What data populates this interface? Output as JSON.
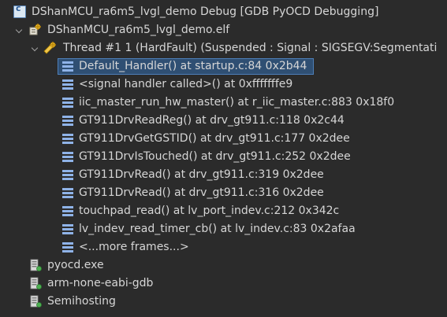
{
  "launch": {
    "label": "DShanMCU_ra6m5_lvgl_demo Debug [GDB PyOCD Debugging]",
    "icon": "launch-config-icon"
  },
  "process": {
    "label": "DShanMCU_ra6m5_lvgl_demo.elf",
    "icon": "debug-target-icon"
  },
  "thread": {
    "label": "Thread #1 1 (HardFault) (Suspended : Signal : SIGSEGV:Segmentati",
    "icon": "suspended-thread-icon"
  },
  "frames": [
    "Default_Handler() at startup.c:84 0x2b44",
    "<signal handler called>() at 0xfffffffe9",
    "iic_master_run_hw_master() at r_iic_master.c:883 0x18f0",
    "GT911DrvReadReg() at drv_gt911.c:118 0x2c44",
    "GT911DrvGetGSTID() at drv_gt911.c:177 0x2dee",
    "GT911DrvIsTouched() at drv_gt911.c:252 0x2dee",
    "GT911DrvRead() at drv_gt911.c:319 0x2dee",
    "GT911DrvRead() at drv_gt911.c:316 0x2dee",
    "touchpad_read() at lv_port_indev.c:212 0x342c",
    "lv_indev_read_timer_cb() at lv_indev.c:83 0x2afaa",
    "<...more frames...>"
  ],
  "processes": [
    "pyocd.exe",
    "arm-none-eabi-gdb",
    "Semihosting"
  ],
  "colors": {
    "background": "#2b2b2b",
    "text": "#d6d6d6",
    "selection": "#2f4f73",
    "selection_border": "#4e7fb8",
    "frame_icon": "#8fb3e8"
  }
}
